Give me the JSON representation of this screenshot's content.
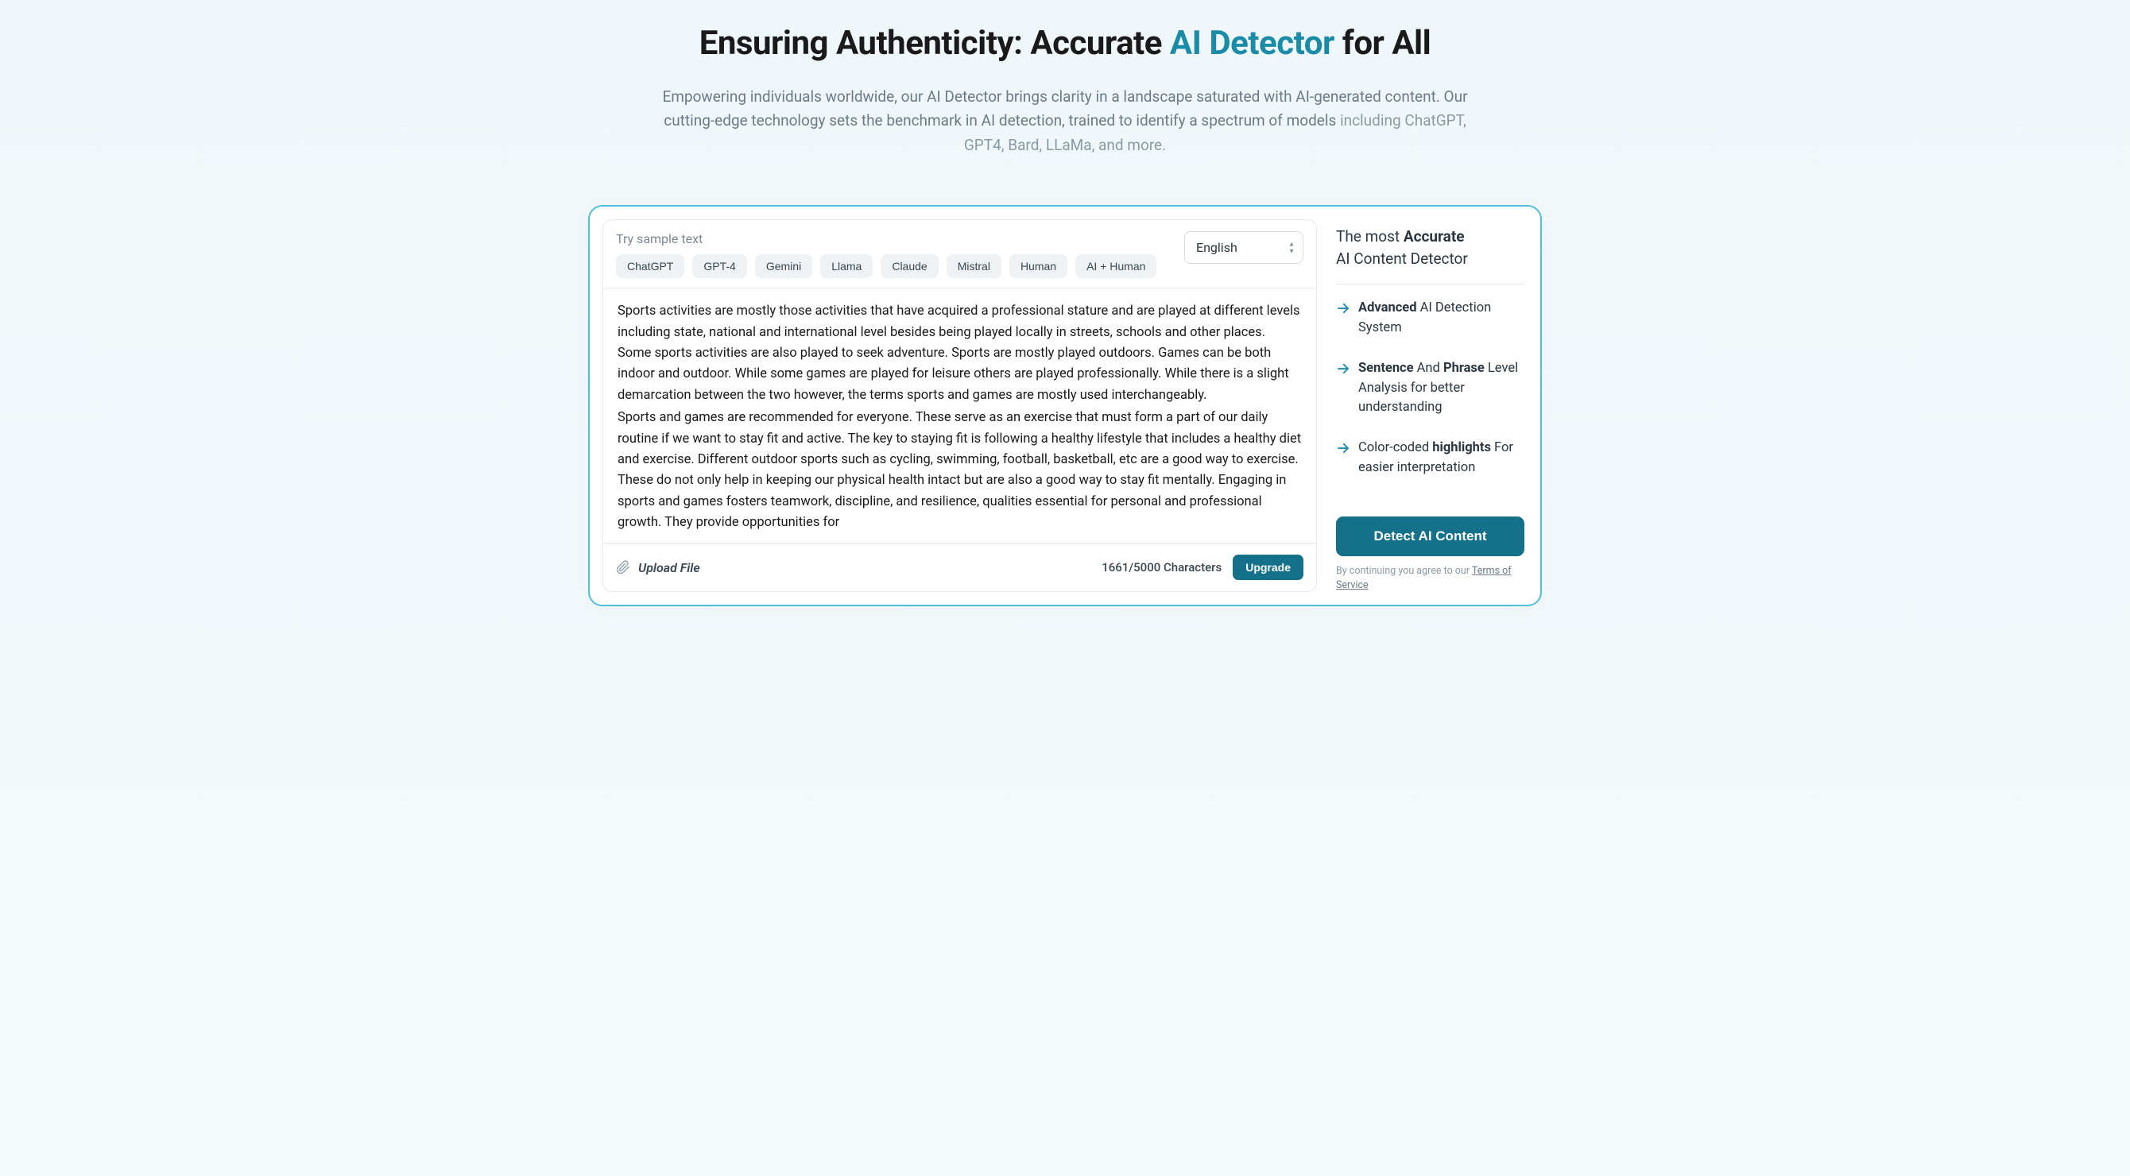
{
  "hero": {
    "title_pre": "Ensuring Authenticity: Accurate ",
    "title_accent": "AI Detector",
    "title_post": " for All",
    "subtitle_main": "Empowering individuals worldwide, our AI Detector brings clarity in a landscape saturated with AI-generated content. Our cutting-edge technology sets the benchmark in AI detection, trained to identify a spectrum of models ",
    "subtitle_models": "including ChatGPT, GPT4, Bard, LLaMa, and more."
  },
  "editor": {
    "sample_label": "Try sample text",
    "chips": [
      "ChatGPT",
      "GPT-4",
      "Gemini",
      "Llama",
      "Claude",
      "Mistral",
      "Human",
      "AI + Human"
    ],
    "language": "English",
    "text_p1": "Sports activities are mostly those activities that have acquired a professional stature and are played at different levels including state, national and international level besides being played locally in streets, schools and other places. Some sports activities are also played to seek adventure. Sports are mostly played outdoors. Games can be both indoor and outdoor. While some games are played for leisure others are played professionally. While there is a slight demarcation between the two however, the terms sports and games are mostly used interchangeably.",
    "text_p2": "Sports and games are recommended for everyone. These serve as an exercise that must form a part of our daily routine if we want to stay fit and active. The key to staying fit is following a healthy lifestyle that includes a healthy diet and exercise. Different outdoor sports such as cycling, swimming, football, basketball, etc are a good way to exercise. These do not only help in keeping our physical health intact but are also a good way to stay fit mentally. Engaging in sports and games fosters teamwork, discipline, and resilience, qualities essential for personal and professional growth. They provide opportunities for",
    "upload_label": "Upload File",
    "char_count": "1661/5000 Characters",
    "upgrade_label": "Upgrade"
  },
  "sidebar": {
    "title_pre": "The most ",
    "title_bold": "Accurate",
    "title_post": " AI Content Detector",
    "features": [
      {
        "b1": "Advanced",
        "t1": " AI Detection System"
      },
      {
        "b1": "Sentence",
        "m1": " And ",
        "b2": "Phrase",
        "t1": " Level Analysis for better understanding"
      },
      {
        "m1": "Color-coded ",
        "b1": "highlights",
        "t1": " For easier interpretation"
      }
    ],
    "detect_label": "Detect AI Content",
    "tos_pre": "By continuing you agree to our ",
    "tos_link": "Terms of Service"
  }
}
